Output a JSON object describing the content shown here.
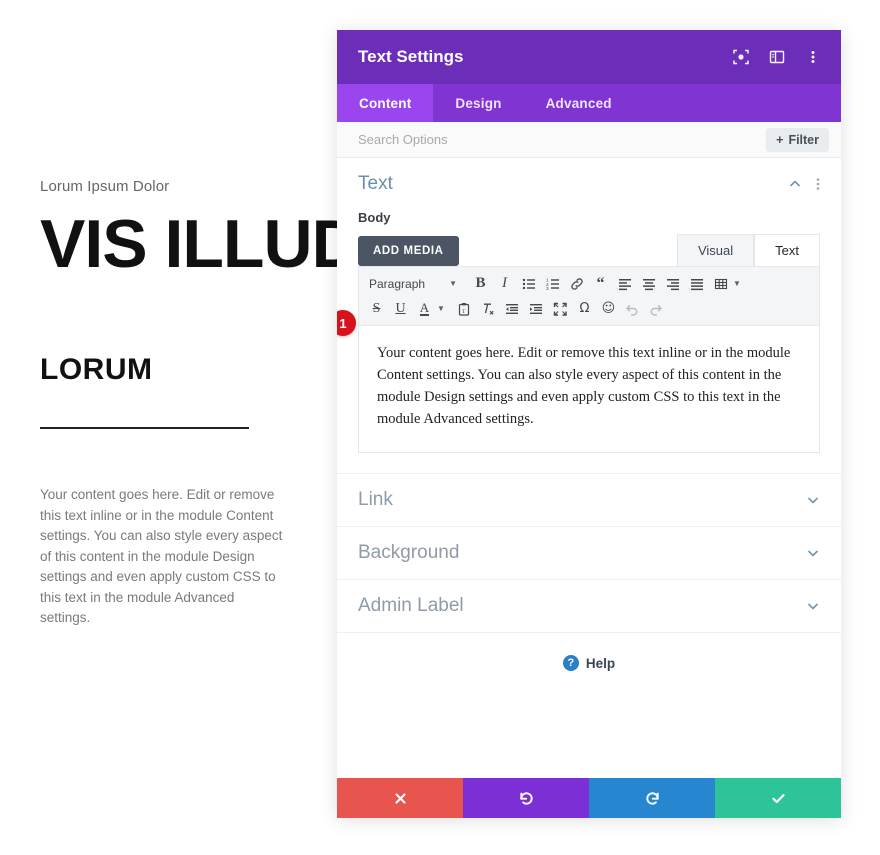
{
  "page_preview": {
    "eyebrow": "Lorum Ipsum Dolor",
    "title": "VIS ILLUD MEDIOCRE",
    "subtitle": "LORUM",
    "body": "Your content goes here. Edit or remove this text inline or in the module Content settings. You can also style every aspect of this content in the module Design settings and even apply custom CSS to this text in the module Advanced settings."
  },
  "modal": {
    "header": {
      "title": "Text Settings",
      "icons": [
        "focus-target-icon",
        "layout-panel-icon",
        "kebab-menu-icon"
      ]
    },
    "tabs": [
      {
        "label": "Content",
        "active": true
      },
      {
        "label": "Design",
        "active": false
      },
      {
        "label": "Advanced",
        "active": false
      }
    ],
    "search": {
      "placeholder": "Search Options",
      "filter_label": "Filter",
      "filter_icon": "plus-icon"
    },
    "sections": [
      {
        "label": "Text",
        "open": true
      },
      {
        "label": "Link",
        "open": false
      },
      {
        "label": "Background",
        "open": false
      },
      {
        "label": "Admin Label",
        "open": false
      }
    ],
    "text_section": {
      "field_label": "Body",
      "add_media_label": "ADD MEDIA",
      "editor_tabs": [
        {
          "label": "Visual",
          "active": false
        },
        {
          "label": "Text",
          "active": true
        }
      ],
      "toolbar_row1": [
        {
          "name": "format-select",
          "label": "Paragraph",
          "type": "select"
        },
        {
          "name": "bold-icon",
          "glyph": "B",
          "type": "text-bold"
        },
        {
          "name": "italic-icon",
          "glyph": "I",
          "type": "text-italic"
        },
        {
          "name": "bulleted-list-icon",
          "type": "svg"
        },
        {
          "name": "numbered-list-icon",
          "type": "svg"
        },
        {
          "name": "link-icon",
          "type": "svg"
        },
        {
          "name": "blockquote-icon",
          "glyph": "“",
          "type": "quote"
        },
        {
          "name": "align-left-icon",
          "type": "svg"
        },
        {
          "name": "align-center-icon",
          "type": "svg"
        },
        {
          "name": "align-right-icon",
          "type": "svg"
        },
        {
          "name": "align-justify-icon",
          "type": "svg"
        },
        {
          "name": "table-icon",
          "type": "svg",
          "caret": true
        }
      ],
      "toolbar_row2": [
        {
          "name": "strikethrough-icon",
          "glyph": "S",
          "type": "text-strike"
        },
        {
          "name": "underline-icon",
          "glyph": "U",
          "type": "text-underline"
        },
        {
          "name": "text-color-icon",
          "glyph": "A",
          "type": "text-color",
          "caret": true
        },
        {
          "name": "paste-as-text-icon",
          "type": "svg"
        },
        {
          "name": "clear-formatting-icon",
          "type": "svg"
        },
        {
          "name": "outdent-icon",
          "type": "svg"
        },
        {
          "name": "indent-icon",
          "type": "svg"
        },
        {
          "name": "fullscreen-icon",
          "type": "svg"
        },
        {
          "name": "special-character-icon",
          "glyph": "Ω",
          "type": "omega"
        },
        {
          "name": "emoji-icon",
          "glyph": "☺",
          "type": "smiley"
        },
        {
          "name": "undo-icon",
          "type": "svg",
          "disabled": true
        },
        {
          "name": "redo-icon",
          "type": "svg",
          "disabled": true
        }
      ],
      "content": "Your content goes here. Edit or remove this text inline or in the module Content settings. You can also style every aspect of this content in the module Design settings and even apply custom CSS to this text in the module Advanced settings.",
      "step_badge": "1"
    },
    "help": {
      "label": "Help",
      "icon": "question-mark-icon"
    },
    "footer_buttons": [
      {
        "name": "cancel-button",
        "icon": "close-x-icon",
        "color": "#e8544e"
      },
      {
        "name": "undo-button",
        "icon": "undo-arrow-icon",
        "color": "#7b2fd4"
      },
      {
        "name": "redo-button",
        "icon": "redo-arrow-icon",
        "color": "#2786d0"
      },
      {
        "name": "save-button",
        "icon": "checkmark-icon",
        "color": "#2ec49a"
      }
    ]
  },
  "colors": {
    "header_purple": "#6c2eb9",
    "tabbar_purple": "#8034d1",
    "active_tab_purple": "#9b45ee",
    "badge_red": "#d8121c"
  }
}
